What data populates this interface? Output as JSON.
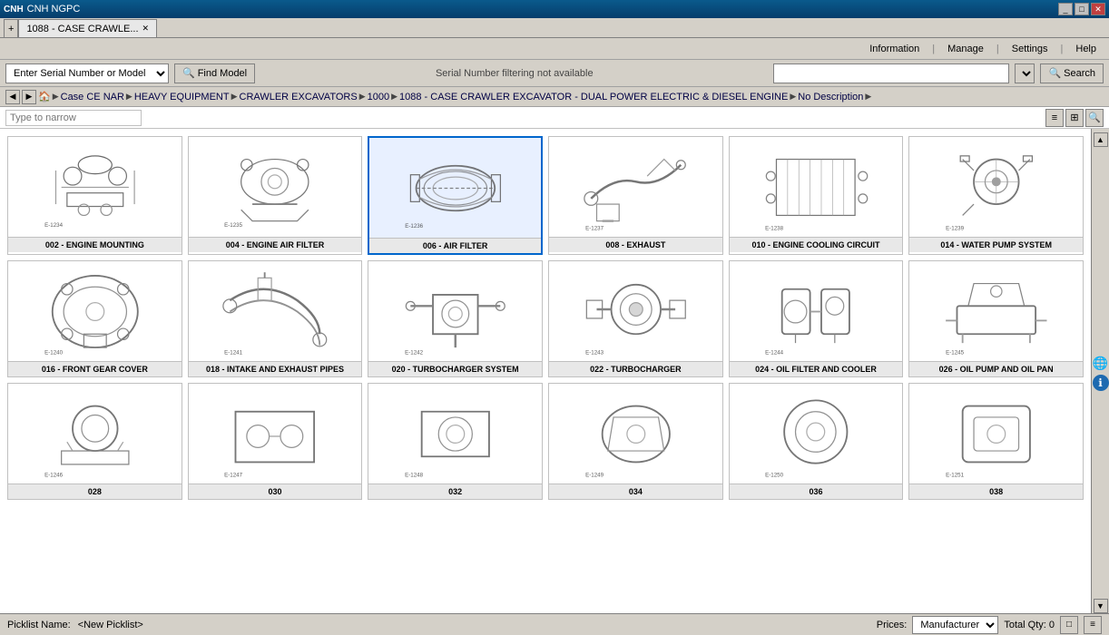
{
  "titleBar": {
    "appName": "CNH NGPC",
    "tabLabel": "1088 - CASE CRAWLE...",
    "controls": [
      "_",
      "□",
      "✕"
    ]
  },
  "menuBar": {
    "items": [
      "Information",
      "Manage",
      "Settings",
      "Help"
    ],
    "separators": [
      "|",
      "|",
      "|"
    ]
  },
  "toolbar": {
    "serialPlaceholder": "Enter Serial Number or Model",
    "findModelLabel": "Find Model",
    "serialStatus": "Serial Number filtering not available",
    "searchPlaceholder": "",
    "searchLabel": "Search"
  },
  "breadcrumb": {
    "items": [
      "Case CE NAR",
      "HEAVY EQUIPMENT",
      "CRAWLER EXCAVATORS",
      "1000",
      "1088 - CASE CRAWLER EXCAVATOR - DUAL POWER ELECTRIC & DIESEL ENGINE",
      "No Description"
    ],
    "homeIcon": "🏠"
  },
  "filterBar": {
    "placeholder": "Type to narrow"
  },
  "parts": [
    {
      "id": "002",
      "label": "002 - ENGINE MOUNTING",
      "selected": false
    },
    {
      "id": "004",
      "label": "004 - ENGINE AIR FILTER",
      "selected": false
    },
    {
      "id": "006",
      "label": "006 - AIR FILTER",
      "selected": true
    },
    {
      "id": "008",
      "label": "008 - EXHAUST",
      "selected": false
    },
    {
      "id": "010",
      "label": "010 - ENGINE COOLING CIRCUIT",
      "selected": false
    },
    {
      "id": "014",
      "label": "014 - WATER PUMP SYSTEM",
      "selected": false
    },
    {
      "id": "016",
      "label": "016 - FRONT GEAR COVER",
      "selected": false
    },
    {
      "id": "018",
      "label": "018 - INTAKE AND EXHAUST PIPES",
      "selected": false
    },
    {
      "id": "020",
      "label": "020 - TURBOCHARGER SYSTEM",
      "selected": false
    },
    {
      "id": "022",
      "label": "022 - TURBOCHARGER",
      "selected": false
    },
    {
      "id": "024",
      "label": "024 - OIL FILTER AND COOLER",
      "selected": false
    },
    {
      "id": "026",
      "label": "026 - OIL PUMP AND OIL PAN",
      "selected": false
    },
    {
      "id": "028",
      "label": "028",
      "selected": false
    },
    {
      "id": "030",
      "label": "030",
      "selected": false
    },
    {
      "id": "032",
      "label": "032",
      "selected": false
    },
    {
      "id": "034",
      "label": "034",
      "selected": false
    },
    {
      "id": "036",
      "label": "036",
      "selected": false
    },
    {
      "id": "038",
      "label": "038",
      "selected": false
    }
  ],
  "statusBar": {
    "picklistLabel": "Picklist Name:",
    "picklistValue": "<New Picklist>",
    "pricesLabel": "Prices:",
    "pricesOption": "Manufacturer",
    "totalQtyLabel": "Total Qty: 0"
  },
  "sidebar": {
    "scrollUp": "▲",
    "scrollDown": "▼",
    "globeIcon": "🌐",
    "infoIcon": "ℹ"
  }
}
